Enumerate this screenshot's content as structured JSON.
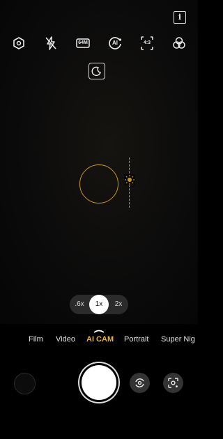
{
  "top_bar": {
    "info_icon": "info-icon",
    "info_label": "i",
    "icons": [
      "settings-hexagon-icon",
      "flash-off-icon",
      "resolution-64m-icon",
      "ai-mode-icon",
      "aspect-ratio-icon",
      "filters-icon"
    ],
    "resolution_label": "64M",
    "ai_label": "AI",
    "aspect_label": "4:3"
  },
  "night_mode_icon": "moon-icon",
  "focus": {
    "ring_color": "#c8962a",
    "exposure_icon": "sun-icon"
  },
  "zoom": {
    "options": [
      ".6x",
      "1x",
      "2x"
    ],
    "selected": "1x"
  },
  "modes": {
    "items": [
      "Film",
      "Video",
      "AI CAM",
      "Portrait",
      "Super Nig"
    ],
    "selected": "AI CAM",
    "accent": "#f0b429"
  },
  "bottom": {
    "gallery_icon": "gallery-thumbnail",
    "shutter_icon": "shutter-button",
    "switch_camera_icon": "switch-camera-icon",
    "lens_icon": "google-lens-icon"
  }
}
